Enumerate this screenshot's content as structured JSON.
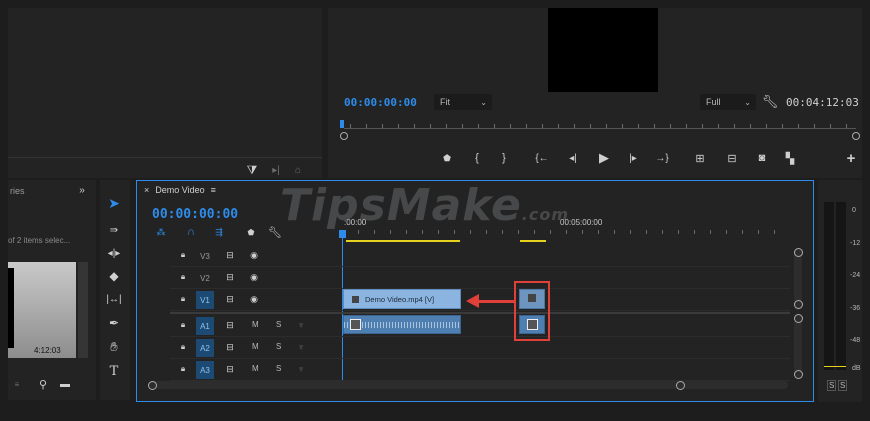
{
  "program_monitor": {
    "timecode": "00:00:00:00",
    "fit_label": "Fit",
    "quality_label": "Full",
    "duration": "00:04:12:03"
  },
  "project_panel": {
    "tab_label": "ries",
    "selection_text": "of 2 items selec...",
    "thumb_duration": "4:12:03"
  },
  "timeline": {
    "tab_label": "Demo Video",
    "timecode": "00:00:00:00",
    "ruler_start": ":00:00",
    "ruler_mark": "00:05:00:00",
    "video_tracks": [
      "V3",
      "V2",
      "V1"
    ],
    "audio_tracks": [
      "A1",
      "A2",
      "A3"
    ],
    "mute_label": "M",
    "solo_label": "S",
    "clip_video_name": "Demo Video.mp4 [V]"
  },
  "audio_meter": {
    "labels": [
      "0",
      "-12",
      "-24",
      "-36",
      "-48",
      "dB"
    ],
    "solo_labels": [
      "S",
      "S"
    ]
  },
  "watermark": {
    "text": "TipsMake",
    "suffix": ".com"
  },
  "colors": {
    "accent_blue": "#2d8ceb",
    "clip_blue": "#8bb5e0",
    "highlight_red": "#e0403a",
    "work_area_yellow": "#e6d21e"
  }
}
